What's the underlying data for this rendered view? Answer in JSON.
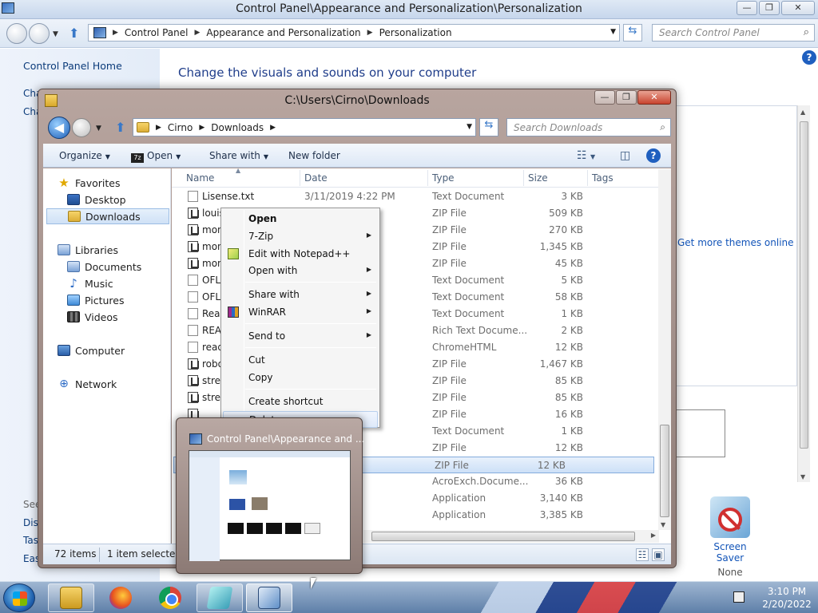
{
  "control_panel": {
    "title": "Control Panel\\Appearance and Personalization\\Personalization",
    "breadcrumb": [
      "Control Panel",
      "Appearance and Personalization",
      "Personalization"
    ],
    "search_placeholder": "Search Control Panel",
    "home_link": "Control Panel Home",
    "left_fragments": [
      "Cha",
      "Cha",
      "See",
      "Disp",
      "Tas",
      "Eas"
    ],
    "heading": "Change the visuals and sounds on your computer",
    "get_themes": "Get more themes online",
    "screen_saver": {
      "label": "Screen Saver",
      "value": "None"
    }
  },
  "explorer": {
    "title": "C:\\Users\\Cirno\\Downloads",
    "breadcrumb": [
      "Cirno",
      "Downloads"
    ],
    "search_placeholder": "Search Downloads",
    "toolbar": {
      "organize": "Organize",
      "open": "Open",
      "share_with": "Share with",
      "new_folder": "New folder"
    },
    "nav": {
      "favorites": "Favorites",
      "desktop": "Desktop",
      "downloads": "Downloads",
      "libraries": "Libraries",
      "documents": "Documents",
      "music": "Music",
      "pictures": "Pictures",
      "videos": "Videos",
      "computer": "Computer",
      "network": "Network"
    },
    "columns": {
      "name": "Name",
      "date": "Date",
      "type": "Type",
      "size": "Size",
      "tags": "Tags"
    },
    "rows": [
      {
        "name": "Lisense.txt",
        "date": "3/11/2019 4:22 PM",
        "type": "Text Document",
        "size": "3 KB"
      },
      {
        "name": "louis",
        "date": "",
        "type": "ZIP File",
        "size": "509 KB"
      },
      {
        "name": "mon",
        "date": "",
        "type": "ZIP File",
        "size": "270 KB"
      },
      {
        "name": "mon",
        "date": "",
        "type": "ZIP File",
        "size": "1,345 KB"
      },
      {
        "name": "mon",
        "date": "",
        "type": "ZIP File",
        "size": "45 KB"
      },
      {
        "name": "OFL",
        "date": "",
        "type": "Text Document",
        "size": "5 KB"
      },
      {
        "name": "OFL",
        "date": "",
        "type": "Text Document",
        "size": "58 KB"
      },
      {
        "name": "Read",
        "date": "",
        "type": "Text Document",
        "size": "1 KB"
      },
      {
        "name": "REA",
        "date": "",
        "type": "Rich Text Docume...",
        "size": "2 KB"
      },
      {
        "name": "read",
        "date": "M",
        "type": "ChromeHTML",
        "size": "12 KB"
      },
      {
        "name": "robo",
        "date": "",
        "type": "ZIP File",
        "size": "1,467 KB"
      },
      {
        "name": "stret",
        "date": "",
        "type": "ZIP File",
        "size": "85 KB"
      },
      {
        "name": "stret",
        "date": "",
        "type": "ZIP File",
        "size": "85 KB"
      },
      {
        "name": "",
        "date": "",
        "type": "ZIP File",
        "size": "16 KB"
      },
      {
        "name": "",
        "date": "",
        "type": "Text Document",
        "size": "1 KB"
      },
      {
        "name": "",
        "date": "",
        "type": "ZIP File",
        "size": "12 KB"
      },
      {
        "name": "",
        "date": "",
        "type": "ZIP File",
        "size": "12 KB"
      },
      {
        "name": "",
        "date": "AM",
        "type": "AcroExch.Docume...",
        "size": "36 KB"
      },
      {
        "name": "",
        "date": "PM",
        "type": "Application",
        "size": "3,140 KB"
      },
      {
        "name": "",
        "date": "PM",
        "type": "Application",
        "size": "3,385 KB"
      }
    ],
    "status": {
      "count": "72 items",
      "selected": "1 item selected"
    }
  },
  "context_menu": {
    "open": "Open",
    "seven_zip": "7-Zip",
    "edit_notepad": "Edit with Notepad++",
    "open_with": "Open with",
    "share_with": "Share with",
    "winrar": "WinRAR",
    "send_to": "Send to",
    "cut": "Cut",
    "copy": "Copy",
    "create_shortcut": "Create shortcut",
    "delete": "Delete"
  },
  "preview": {
    "title": "Control Panel\\Appearance and ..."
  },
  "tray": {
    "time": "3:10 PM",
    "date": "2/20/2022"
  }
}
